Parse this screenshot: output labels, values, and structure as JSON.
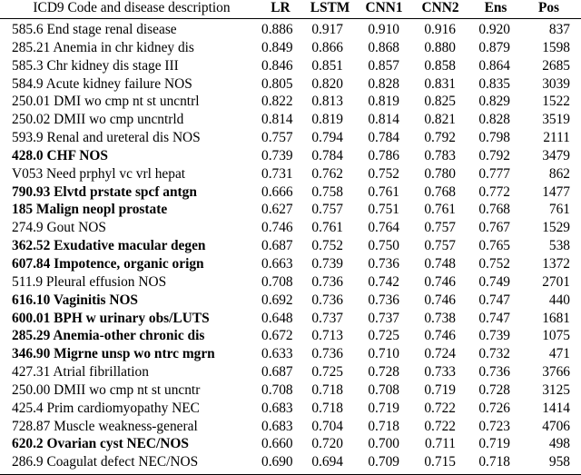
{
  "table": {
    "columns": [
      {
        "key": "desc",
        "label": "ICD9 Code and disease description",
        "align": "left"
      },
      {
        "key": "lr",
        "label": "LR",
        "align": "right"
      },
      {
        "key": "lstm",
        "label": "LSTM",
        "align": "right"
      },
      {
        "key": "cnn1",
        "label": "CNN1",
        "align": "right"
      },
      {
        "key": "cnn2",
        "label": "CNN2",
        "align": "right"
      },
      {
        "key": "ens",
        "label": "Ens",
        "align": "right"
      },
      {
        "key": "pos",
        "label": "Pos",
        "align": "right"
      }
    ],
    "rows": [
      {
        "desc": "585.6 End stage renal disease",
        "lr": "0.886",
        "lstm": "0.917",
        "cnn1": "0.910",
        "cnn2": "0.916",
        "ens": "0.920",
        "pos": "837",
        "bold": false
      },
      {
        "desc": "285.21 Anemia in chr kidney dis",
        "lr": "0.849",
        "lstm": "0.866",
        "cnn1": "0.868",
        "cnn2": "0.880",
        "ens": "0.879",
        "pos": "1598",
        "bold": false
      },
      {
        "desc": "585.3 Chr kidney dis stage III",
        "lr": "0.846",
        "lstm": "0.851",
        "cnn1": "0.857",
        "cnn2": "0.858",
        "ens": "0.864",
        "pos": "2685",
        "bold": false
      },
      {
        "desc": "584.9 Acute kidney failure NOS",
        "lr": "0.805",
        "lstm": "0.820",
        "cnn1": "0.828",
        "cnn2": "0.831",
        "ens": "0.835",
        "pos": "3039",
        "bold": false
      },
      {
        "desc": "250.01 DMI wo cmp nt st uncntrl",
        "lr": "0.822",
        "lstm": "0.813",
        "cnn1": "0.819",
        "cnn2": "0.825",
        "ens": "0.829",
        "pos": "1522",
        "bold": false
      },
      {
        "desc": "250.02 DMII wo cmp uncntrld",
        "lr": "0.814",
        "lstm": "0.819",
        "cnn1": "0.814",
        "cnn2": "0.821",
        "ens": "0.828",
        "pos": "3519",
        "bold": false
      },
      {
        "desc": "593.9 Renal and ureteral dis NOS",
        "lr": "0.757",
        "lstm": "0.794",
        "cnn1": "0.784",
        "cnn2": "0.792",
        "ens": "0.798",
        "pos": "2111",
        "bold": false
      },
      {
        "desc": "428.0 CHF NOS",
        "lr": "0.739",
        "lstm": "0.784",
        "cnn1": "0.786",
        "cnn2": "0.783",
        "ens": "0.792",
        "pos": "3479",
        "bold": true
      },
      {
        "desc": "V053 Need prphyl vc vrl hepat",
        "lr": "0.731",
        "lstm": "0.762",
        "cnn1": "0.752",
        "cnn2": "0.780",
        "ens": "0.777",
        "pos": "862",
        "bold": false
      },
      {
        "desc": "790.93 Elvtd prstate spcf antgn",
        "lr": "0.666",
        "lstm": "0.758",
        "cnn1": "0.761",
        "cnn2": "0.768",
        "ens": "0.772",
        "pos": "1477",
        "bold": true
      },
      {
        "desc": "185 Malign neopl prostate",
        "lr": "0.627",
        "lstm": "0.757",
        "cnn1": "0.751",
        "cnn2": "0.761",
        "ens": "0.768",
        "pos": "761",
        "bold": true
      },
      {
        "desc": "274.9 Gout NOS",
        "lr": "0.746",
        "lstm": "0.761",
        "cnn1": "0.764",
        "cnn2": "0.757",
        "ens": "0.767",
        "pos": "1529",
        "bold": false
      },
      {
        "desc": "362.52 Exudative macular degen",
        "lr": "0.687",
        "lstm": "0.752",
        "cnn1": "0.750",
        "cnn2": "0.757",
        "ens": "0.765",
        "pos": "538",
        "bold": true
      },
      {
        "desc": "607.84 Impotence, organic orign",
        "lr": "0.663",
        "lstm": "0.739",
        "cnn1": "0.736",
        "cnn2": "0.748",
        "ens": "0.752",
        "pos": "1372",
        "bold": true
      },
      {
        "desc": "511.9 Pleural effusion NOS",
        "lr": "0.708",
        "lstm": "0.736",
        "cnn1": "0.742",
        "cnn2": "0.746",
        "ens": "0.749",
        "pos": "2701",
        "bold": false
      },
      {
        "desc": "616.10 Vaginitis NOS",
        "lr": "0.692",
        "lstm": "0.736",
        "cnn1": "0.736",
        "cnn2": "0.746",
        "ens": "0.747",
        "pos": "440",
        "bold": true
      },
      {
        "desc": "600.01 BPH w urinary obs/LUTS",
        "lr": "0.648",
        "lstm": "0.737",
        "cnn1": "0.737",
        "cnn2": "0.738",
        "ens": "0.747",
        "pos": "1681",
        "bold": true
      },
      {
        "desc": "285.29 Anemia-other chronic dis",
        "lr": "0.672",
        "lstm": "0.713",
        "cnn1": "0.725",
        "cnn2": "0.746",
        "ens": "0.739",
        "pos": "1075",
        "bold": true
      },
      {
        "desc": "346.90 Migrne unsp wo ntrc mgrn",
        "lr": "0.633",
        "lstm": "0.736",
        "cnn1": "0.710",
        "cnn2": "0.724",
        "ens": "0.732",
        "pos": "471",
        "bold": true
      },
      {
        "desc": "427.31 Atrial fibrillation",
        "lr": "0.687",
        "lstm": "0.725",
        "cnn1": "0.728",
        "cnn2": "0.733",
        "ens": "0.736",
        "pos": "3766",
        "bold": false
      },
      {
        "desc": "250.00 DMII wo cmp nt st uncntr",
        "lr": "0.708",
        "lstm": "0.718",
        "cnn1": "0.708",
        "cnn2": "0.719",
        "ens": "0.728",
        "pos": "3125",
        "bold": false
      },
      {
        "desc": "425.4 Prim cardiomyopathy NEC",
        "lr": "0.683",
        "lstm": "0.718",
        "cnn1": "0.719",
        "cnn2": "0.722",
        "ens": "0.726",
        "pos": "1414",
        "bold": false
      },
      {
        "desc": "728.87 Muscle weakness-general",
        "lr": "0.683",
        "lstm": "0.704",
        "cnn1": "0.718",
        "cnn2": "0.722",
        "ens": "0.723",
        "pos": "4706",
        "bold": false
      },
      {
        "desc": "620.2 Ovarian cyst NEC/NOS",
        "lr": "0.660",
        "lstm": "0.720",
        "cnn1": "0.700",
        "cnn2": "0.711",
        "ens": "0.719",
        "pos": "498",
        "bold": true
      },
      {
        "desc": "286.9 Coagulat defect NEC/NOS",
        "lr": "0.690",
        "lstm": "0.694",
        "cnn1": "0.709",
        "cnn2": "0.715",
        "ens": "0.718",
        "pos": "958",
        "bold": false
      }
    ]
  }
}
